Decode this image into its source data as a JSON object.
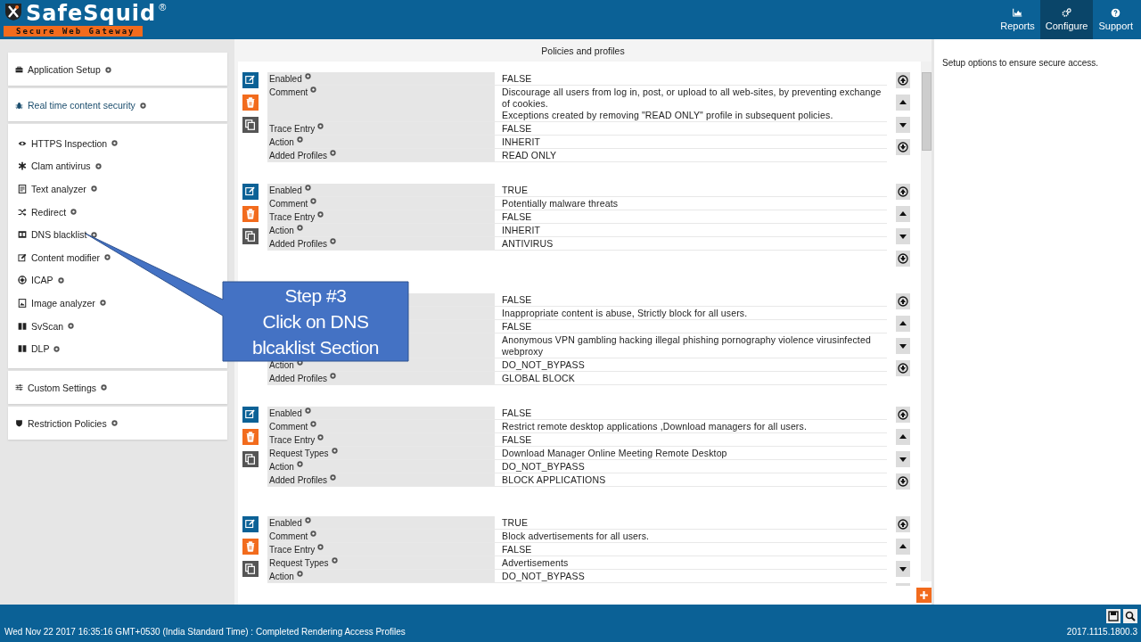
{
  "header": {
    "brand": "SafeSquid",
    "brand_mark": "®",
    "tagline": "Secure Web Gateway",
    "nav": [
      {
        "label": "Reports",
        "kind": "chart",
        "selected": false
      },
      {
        "label": "Configure",
        "kind": "gears",
        "selected": true
      },
      {
        "label": "Support",
        "kind": "help",
        "selected": false
      }
    ]
  },
  "sidebar": {
    "groups": [
      {
        "items": [
          {
            "label": "Application Setup",
            "kind": "briefcase",
            "selected": false
          }
        ]
      },
      {
        "items": [
          {
            "label": "Real time content security",
            "kind": "bug",
            "selected": true
          }
        ]
      },
      {
        "items": [
          {
            "label": "HTTPS Inspection",
            "kind": "eye",
            "selected": false
          },
          {
            "label": "Clam antivirus",
            "kind": "asterisk",
            "selected": false
          },
          {
            "label": "Text analyzer",
            "kind": "doc",
            "selected": false
          },
          {
            "label": "Redirect",
            "kind": "shuffle",
            "selected": false
          },
          {
            "label": "DNS blacklist",
            "kind": "dns",
            "selected": false
          },
          {
            "label": "Content modifier",
            "kind": "edit",
            "selected": false
          },
          {
            "label": "ICAP",
            "kind": "icap",
            "selected": false
          },
          {
            "label": "Image analyzer",
            "kind": "image",
            "selected": false
          },
          {
            "label": "SvScan",
            "kind": "columns",
            "selected": false
          },
          {
            "label": "DLP",
            "kind": "columns",
            "selected": false
          }
        ]
      },
      {
        "items": [
          {
            "label": "Custom Settings",
            "kind": "sliders",
            "selected": false
          }
        ]
      },
      {
        "items": [
          {
            "label": "Restriction Policies",
            "kind": "shield",
            "selected": false
          }
        ]
      }
    ]
  },
  "main": {
    "title": "Policies and profiles",
    "policies": [
      {
        "tools_visible": true,
        "rows": [
          {
            "label": "Enabled",
            "value": "FALSE"
          },
          {
            "label": "Comment",
            "value": "Discourage all users from log in, post, or upload to all web-sites, by preventing exchange of cookies.\nExceptions created by removing \"READ ONLY\" profile in subsequent policies."
          },
          {
            "label": "Trace Entry",
            "value": "FALSE"
          },
          {
            "label": "Action",
            "value": "INHERIT"
          },
          {
            "label": "Added Profiles",
            "value": "READ ONLY"
          }
        ]
      },
      {
        "tools_visible": true,
        "rows": [
          {
            "label": "Enabled",
            "value": "TRUE"
          },
          {
            "label": "Comment",
            "value": "Potentially malware threats"
          },
          {
            "label": "Trace Entry",
            "value": "FALSE"
          },
          {
            "label": "Action",
            "value": "INHERIT"
          },
          {
            "label": "Added Profiles",
            "value": "ANTIVIRUS"
          }
        ]
      },
      {
        "tools_visible": false,
        "rows": [
          {
            "value": "FALSE"
          },
          {
            "value": "Inappropriate content is abuse, Strictly block for all users."
          },
          {
            "value": "FALSE"
          },
          {
            "value": "Anonymous VPN  gambling  hacking  illegal  phishing  pornography  violence  virusinfected  webproxy"
          },
          {
            "label": "Action",
            "value": "DO_NOT_BYPASS"
          },
          {
            "label": "Added Profiles",
            "value": "GLOBAL BLOCK"
          }
        ]
      },
      {
        "tools_visible": true,
        "rows": [
          {
            "label": "Enabled",
            "value": "FALSE"
          },
          {
            "label": "Comment",
            "value": "Restrict remote desktop applications ,Download managers for all users."
          },
          {
            "label": "Trace Entry",
            "value": "FALSE"
          },
          {
            "label": "Request Types",
            "value": "Download Manager  Online Meeting  Remote Desktop"
          },
          {
            "label": "Action",
            "value": "DO_NOT_BYPASS"
          },
          {
            "label": "Added Profiles",
            "value": "BLOCK APPLICATIONS"
          }
        ]
      },
      {
        "tools_visible": true,
        "rows": [
          {
            "label": "Enabled",
            "value": "TRUE"
          },
          {
            "label": "Comment",
            "value": "Block advertisements for all users."
          },
          {
            "label": "Trace Entry",
            "value": "FALSE"
          },
          {
            "label": "Request Types",
            "value": "Advertisements"
          },
          {
            "label": "Action",
            "value": "DO_NOT_BYPASS"
          }
        ]
      }
    ]
  },
  "aside": {
    "text": "Setup options to ensure secure access."
  },
  "callout": {
    "lines": [
      "Step #3",
      "Click on DNS",
      "blcaklist Section"
    ]
  },
  "status_bar": {
    "message": "Wed Nov 22 2017 16:35:16 GMT+0530 (India Standard Time) : Completed Rendering Access Profiles",
    "version": "2017.1115.1800.3"
  }
}
